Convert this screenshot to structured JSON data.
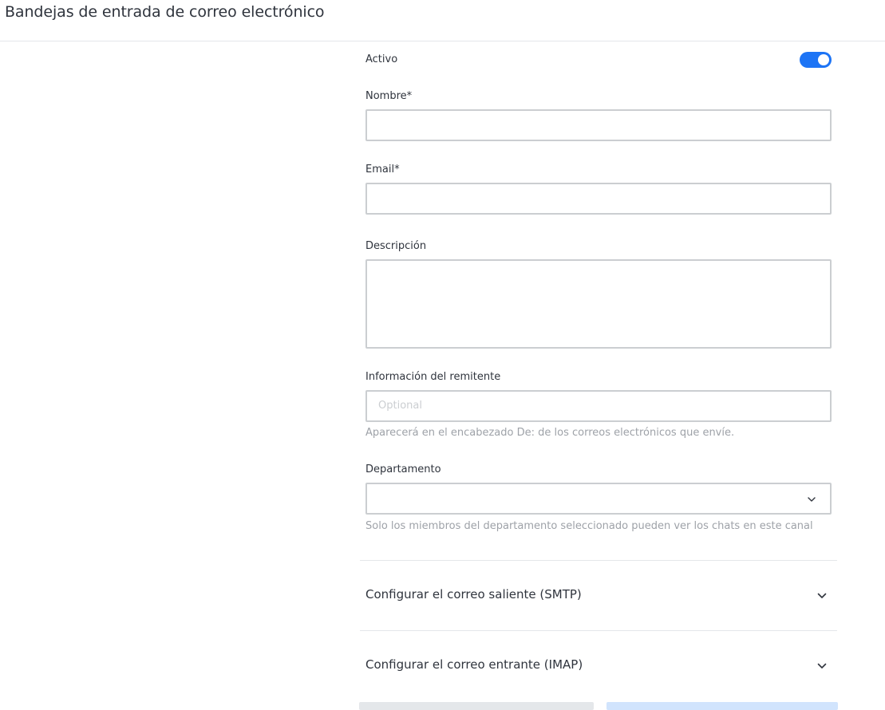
{
  "header": {
    "title": "Bandejas de entrada de correo electrónico"
  },
  "form": {
    "active": {
      "label": "Activo",
      "on": true
    },
    "name": {
      "label": "Nombre*",
      "value": ""
    },
    "email": {
      "label": "Email*",
      "value": ""
    },
    "description": {
      "label": "Descripción",
      "value": ""
    },
    "sender_info": {
      "label": "Información del remitente",
      "placeholder": "Optional",
      "hint": "Aparecerá en el encabezado De: de los correos electrónicos que envíe."
    },
    "department": {
      "label": "Departamento",
      "value": "",
      "hint": "Solo los miembros del departamento seleccionado pueden ver los chats en este canal"
    }
  },
  "sections": [
    {
      "title": "Configurar el correo saliente (SMTP)",
      "icon": "chevron-down-icon"
    },
    {
      "title": "Configurar el correo entrante (IMAP)",
      "icon": "chevron-down-icon"
    }
  ],
  "colors": {
    "accent": "#1d74f5",
    "border": "#cbced1",
    "hint": "#9ea2a8",
    "text": "#2f343d"
  }
}
